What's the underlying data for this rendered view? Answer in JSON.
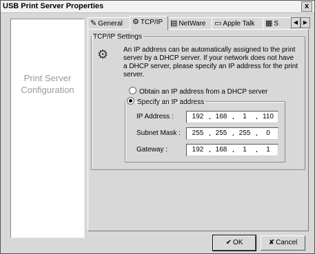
{
  "window": {
    "title": "USB Print Server Properties",
    "close_label": "x"
  },
  "left_panel": {
    "line1": "Print Server",
    "line2": "Configuration"
  },
  "tabs": [
    {
      "label": "General",
      "icon": "general-icon",
      "glyph": "✎"
    },
    {
      "label": "TCP/IP",
      "icon": "tcpip-icon",
      "glyph": "⚙"
    },
    {
      "label": "NetWare",
      "icon": "netware-icon",
      "glyph": "▤"
    },
    {
      "label": "Apple Talk",
      "icon": "appletalk-icon",
      "glyph": "▭"
    },
    {
      "label": "S",
      "icon": "snmp-icon",
      "glyph": "▦"
    }
  ],
  "tab_scroll": {
    "left": "◀",
    "right": "▶"
  },
  "tcpip": {
    "group_title": "TCP/IP Settings",
    "info_icon_glyph": "⚙",
    "info_text": "An IP address can be automatically assigned to the print server by a DHCP server. If your network does not have a DHCP server, please specify an IP address for the print server.",
    "dhcp_option": "Obtain an IP address from a DHCP server",
    "specify_option": "Specify an IP address",
    "selected_option": "specify",
    "ip_label": "IP Address :",
    "ip": [
      "192",
      "168",
      "1",
      "110"
    ],
    "mask_label": "Subnet Mask :",
    "mask": [
      "255",
      "255",
      "255",
      "0"
    ],
    "gateway_label": "Gateway :",
    "gateway": [
      "192",
      "168",
      "1",
      "1"
    ],
    "dot": "."
  },
  "buttons": {
    "ok_label": "OK",
    "ok_glyph": "✔",
    "cancel_label": "Cancel",
    "cancel_glyph": "✘"
  }
}
